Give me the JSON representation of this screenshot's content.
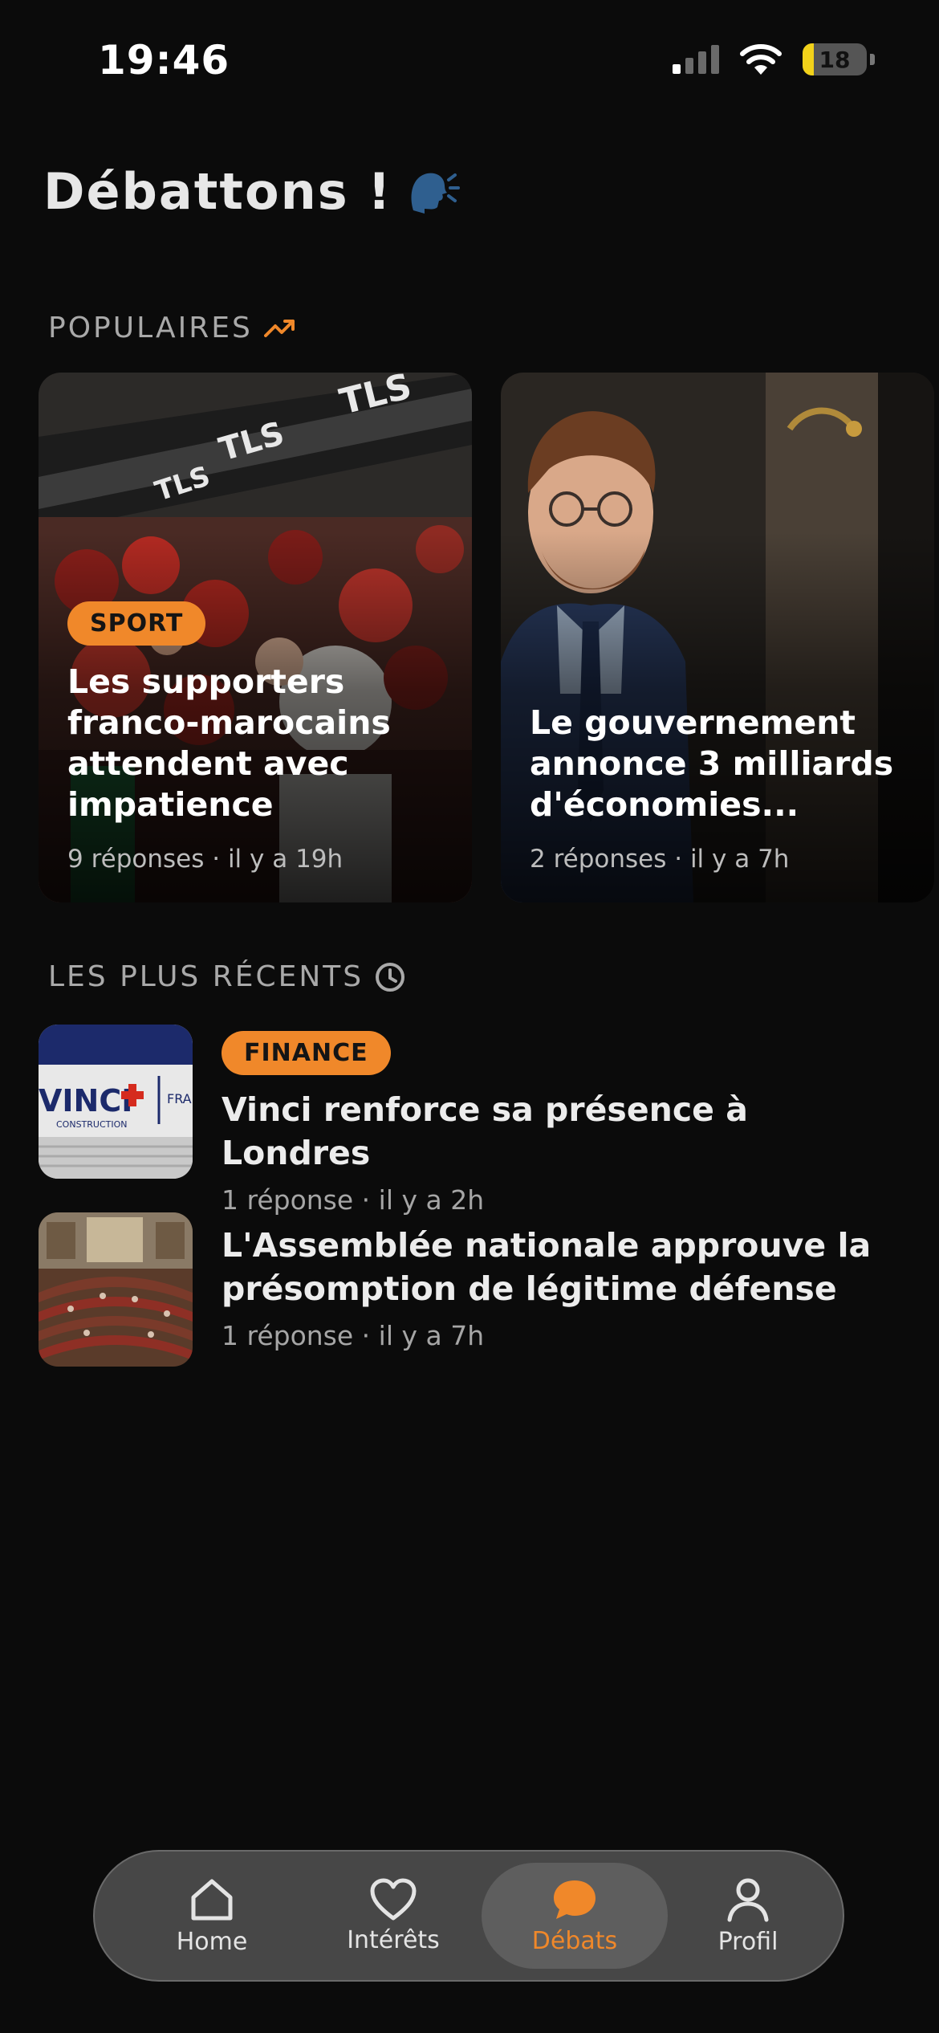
{
  "status_bar": {
    "time": "19:46",
    "battery": "18",
    "battery_level": 0.18
  },
  "header": {
    "title": "Débattons !",
    "title_icon": "speaking-head-icon"
  },
  "popular": {
    "section_title": "POPULAIRES",
    "section_icon": "trending-up-icon",
    "cards": [
      {
        "tag": "SPORT",
        "title": "Les supporters franco-marocains attendent avec impatience",
        "meta": "9 réponses · il y a 19h"
      },
      {
        "tag": "",
        "title": "Le gouvernement annonce 3 milliards d'économies...",
        "meta": "2 réponses · il y a 7h"
      }
    ]
  },
  "recent": {
    "section_title": "LES PLUS RÉCENTS",
    "section_icon": "clock-icon",
    "items": [
      {
        "tag": "FINANCE",
        "title": "Vinci renforce sa présence à Londres",
        "meta": "1 réponse · il y a 2h",
        "thumb_logo": "VINCI",
        "thumb_sub": "CONSTRUCTION",
        "thumb_side": "FRA"
      },
      {
        "tag": "",
        "title": "L'Assemblée nationale approuve la présomption de légitime défense",
        "meta": "1 réponse · il y a 7h"
      }
    ]
  },
  "tabbar": {
    "active": "Débats",
    "accent_color": "#f0882a",
    "items": [
      {
        "label": "Home",
        "icon": "home-icon"
      },
      {
        "label": "Intérêts",
        "icon": "heart-icon"
      },
      {
        "label": "Débats",
        "icon": "chat-bubble-icon"
      },
      {
        "label": "Profil",
        "icon": "user-icon"
      }
    ]
  }
}
